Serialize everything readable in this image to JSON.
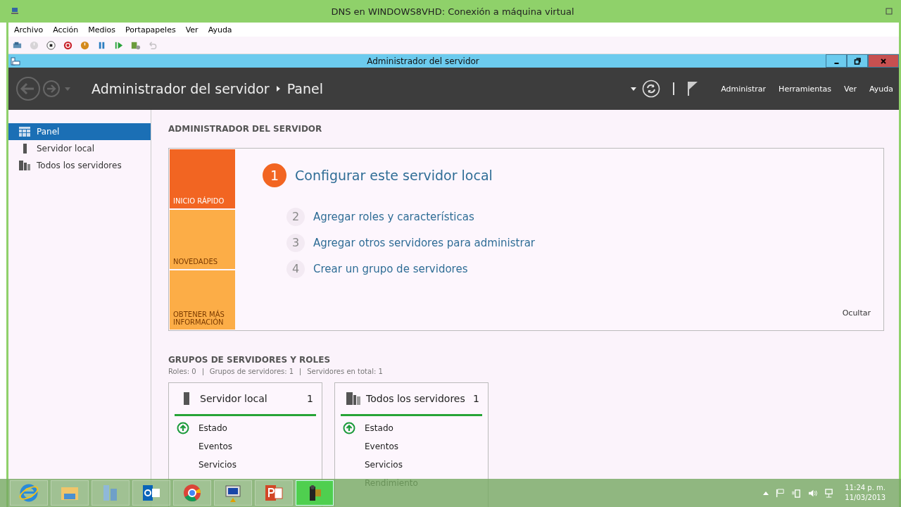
{
  "vm_window": {
    "title": "DNS en WINDOWS8VHD: Conexión a máquina virtual"
  },
  "menu_bar": [
    "Archivo",
    "Acción",
    "Medios",
    "Portapapeles",
    "Ver",
    "Ayuda"
  ],
  "toolbar": [
    {
      "kind": "ctrl-alt-del",
      "disabled": false
    },
    {
      "kind": "start",
      "disabled": true
    },
    {
      "kind": "stop",
      "disabled": false
    },
    {
      "kind": "shutdown",
      "disabled": false
    },
    {
      "kind": "save",
      "disabled": false
    },
    {
      "kind": "pause",
      "disabled": false
    },
    {
      "kind": "resume",
      "disabled": false
    },
    {
      "kind": "checkpoint",
      "disabled": false
    },
    {
      "kind": "revert",
      "disabled": true
    }
  ],
  "app_window": {
    "title": "Administrador del servidor"
  },
  "header": {
    "breadcrumb": [
      "Administrador del servidor",
      "Panel"
    ],
    "menus": [
      "Administrar",
      "Herramientas",
      "Ver",
      "Ayuda"
    ]
  },
  "sidebar": {
    "items": [
      {
        "label": "Panel",
        "kind": "dashboard",
        "selected": true
      },
      {
        "label": "Servidor local",
        "kind": "server",
        "selected": false
      },
      {
        "label": "Todos los servidores",
        "kind": "servers",
        "selected": false
      }
    ]
  },
  "welcome": {
    "heading": "ADMINISTRADOR DEL SERVIDOR",
    "tiles": [
      {
        "label": "INICIO RÁPIDO",
        "color": "#f26522",
        "selected": true
      },
      {
        "label": "NOVEDADES",
        "color": "#fcad47",
        "selected": false
      },
      {
        "label": "OBTENER MÁS INFORMACIÓN",
        "color": "#fcad47",
        "selected": false
      }
    ],
    "steps": [
      {
        "number": "1",
        "label": "Configurar este servidor local",
        "primary": true
      },
      {
        "number": "2",
        "label": "Agregar roles y características",
        "primary": false
      },
      {
        "number": "3",
        "label": "Agregar otros servidores para administrar",
        "primary": false
      },
      {
        "number": "4",
        "label": "Crear un grupo de servidores",
        "primary": false
      }
    ],
    "hide": "Ocultar"
  },
  "groups": {
    "heading": "GRUPOS DE SERVIDORES Y ROLES",
    "summary": [
      "Roles: 0",
      "Grupos de servidores: 1",
      "Servidores en total: 1"
    ],
    "cards": [
      {
        "kind": "server",
        "title": "Servidor local",
        "count": "1",
        "items": [
          "Estado",
          "Eventos",
          "Servicios"
        ]
      },
      {
        "kind": "servers",
        "title": "Todos los servidores",
        "count": "1",
        "items": [
          "Estado",
          "Eventos",
          "Servicios",
          "Rendimiento"
        ]
      }
    ]
  },
  "taskbar": {
    "apps": [
      {
        "kind": "ie",
        "active": false
      },
      {
        "kind": "explorer",
        "active": false
      },
      {
        "kind": "servermgr",
        "active": false
      },
      {
        "kind": "outlook",
        "active": false
      },
      {
        "kind": "chrome",
        "active": false
      },
      {
        "kind": "remote",
        "active": false
      },
      {
        "kind": "powerpoint",
        "active": false
      },
      {
        "kind": "camera",
        "active": true
      }
    ],
    "time": "11:24 p. m.",
    "date": "11/03/2013"
  }
}
